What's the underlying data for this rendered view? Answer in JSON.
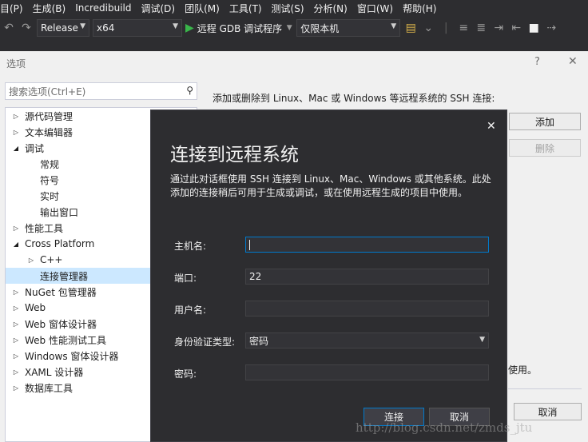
{
  "menubar": {
    "items": [
      "目(P)",
      "生成(B)",
      "Incredibuild",
      "调试(D)",
      "团队(M)",
      "工具(T)",
      "测试(S)",
      "分析(N)",
      "窗口(W)",
      "帮助(H)"
    ]
  },
  "toolbar": {
    "undo_icon": "undo-icon",
    "redo_icon": "redo-icon",
    "config": "Release",
    "platform": "x64",
    "debugger": "远程 GDB 调试程序",
    "target": "仅限本机"
  },
  "options": {
    "title": "选项",
    "help": "?",
    "close": "✕",
    "search_placeholder": "搜索选项(Ctrl+E)",
    "tree": [
      {
        "label": "源代码管理",
        "level": 0,
        "expanded": false
      },
      {
        "label": "文本编辑器",
        "level": 0,
        "expanded": false
      },
      {
        "label": "调试",
        "level": 0,
        "expanded": true
      },
      {
        "label": "常规",
        "level": 1,
        "expanded": null
      },
      {
        "label": "符号",
        "level": 1,
        "expanded": null
      },
      {
        "label": "实时",
        "level": 1,
        "expanded": null
      },
      {
        "label": "输出窗口",
        "level": 1,
        "expanded": null
      },
      {
        "label": "性能工具",
        "level": 0,
        "expanded": false
      },
      {
        "label": "Cross Platform",
        "level": 0,
        "expanded": true
      },
      {
        "label": "C++",
        "level": 1,
        "expanded": false
      },
      {
        "label": "连接管理器",
        "level": 1,
        "expanded": null,
        "selected": true
      },
      {
        "label": "NuGet 包管理器",
        "level": 0,
        "expanded": false
      },
      {
        "label": "Web",
        "level": 0,
        "expanded": false
      },
      {
        "label": "Web 窗体设计器",
        "level": 0,
        "expanded": false
      },
      {
        "label": "Web 性能测试工具",
        "level": 0,
        "expanded": false
      },
      {
        "label": "Windows 窗体设计器",
        "level": 0,
        "expanded": false
      },
      {
        "label": "XAML 设计器",
        "level": 0,
        "expanded": false
      },
      {
        "label": "数据库工具",
        "level": 0,
        "expanded": false
      }
    ],
    "ssh_description": "添加或删除到 Linux、Mac 或 Windows 等远程系统的 SSH 连接:",
    "add_button": "添加",
    "remove_button": "删除",
    "fragment_text": "使用。",
    "cancel_button": "取消"
  },
  "connect_dialog": {
    "title": "连接到远程系统",
    "description": "通过此对话框使用 SSH 连接到 Linux、Mac、Windows 或其他系统。此处添加的连接稍后可用于生成或调试，或在使用远程生成的项目中使用。",
    "close": "✕",
    "host_label": "主机名:",
    "host_value": "",
    "port_label": "端口:",
    "port_value": "22",
    "user_label": "用户名:",
    "user_value": "",
    "auth_label": "身份验证类型:",
    "auth_value": "密码",
    "password_label": "密码:",
    "password_value": "",
    "connect_button": "连接",
    "cancel_button": "取消"
  },
  "watermark": "http://blog.csdn.net/zmds_jtu"
}
